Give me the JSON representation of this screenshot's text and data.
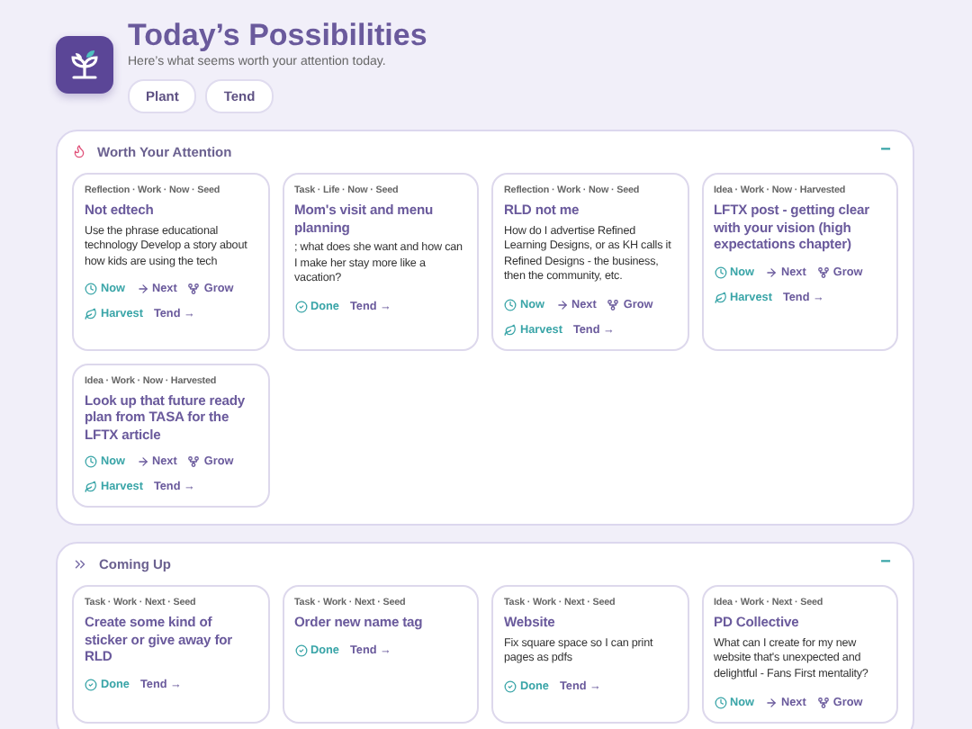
{
  "header": {
    "title": "Today’s Possibilities",
    "subtitle": "Here’s what seems worth your attention today.",
    "buttons": [
      "Plant",
      "Tend"
    ]
  },
  "sections": [
    {
      "title": "Worth Your Attention",
      "kind": "attention",
      "expanded": true,
      "toggle": "−",
      "cards": [
        {
          "meta": "Reflection · Work · Now · Seed",
          "title": "Not edtech",
          "body": "Use the phrase educational technology Develop a story about how kids are using the tech",
          "actions": [
            {
              "kind": "now",
              "label": "Now"
            },
            {
              "kind": "next",
              "label": "Next"
            },
            {
              "kind": "grow",
              "label": "Grow"
            },
            {
              "kind": "harvest",
              "label": "Harvest"
            },
            {
              "kind": "tend",
              "label": "Tend →"
            }
          ]
        },
        {
          "meta": "Task · Life · Now · Seed",
          "title": "Mom's visit and menu planning",
          "body": "; what does she want and how can I make her stay more like a vacation?",
          "actions": [
            {
              "kind": "done",
              "label": "Done"
            },
            {
              "kind": "tend",
              "label": "Tend →"
            }
          ]
        },
        {
          "meta": "Reflection · Work · Now · Seed",
          "title": "RLD not me",
          "body": "How do I advertise Refined Learning Designs, or as KH calls it Refined Designs - the business, then the community, etc.",
          "actions": [
            {
              "kind": "now",
              "label": "Now"
            },
            {
              "kind": "next",
              "label": "Next"
            },
            {
              "kind": "grow",
              "label": "Grow"
            },
            {
              "kind": "harvest",
              "label": "Harvest"
            },
            {
              "kind": "tend",
              "label": "Tend →"
            }
          ]
        },
        {
          "meta": "Idea · Work · Now · Harvested",
          "title": "LFTX post - getting clear with your vision (high expectations chapter)",
          "actions": [
            {
              "kind": "now",
              "label": "Now"
            },
            {
              "kind": "next",
              "label": "Next"
            },
            {
              "kind": "grow",
              "label": "Grow"
            },
            {
              "kind": "harvest",
              "label": "Harvest"
            },
            {
              "kind": "tend",
              "label": "Tend →"
            }
          ]
        },
        {
          "meta": "Idea · Work · Now · Harvested",
          "title": "Look up that future ready plan from TASA for the LFTX article",
          "actions": [
            {
              "kind": "now",
              "label": "Now"
            },
            {
              "kind": "next",
              "label": "Next"
            },
            {
              "kind": "grow",
              "label": "Grow"
            },
            {
              "kind": "harvest",
              "label": "Harvest"
            },
            {
              "kind": "tend",
              "label": "Tend →"
            }
          ]
        }
      ]
    },
    {
      "title": "Coming Up",
      "kind": "upcoming",
      "expanded": true,
      "toggle": "−",
      "cards": [
        {
          "meta": "Task · Work · Next · Seed",
          "title": "Create some kind of sticker or give away for RLD",
          "actions": [
            {
              "kind": "done",
              "label": "Done"
            },
            {
              "kind": "tend",
              "label": "Tend →"
            }
          ]
        },
        {
          "meta": "Task · Work · Next · Seed",
          "title": "Order new name tag",
          "actions": [
            {
              "kind": "done",
              "label": "Done"
            },
            {
              "kind": "tend",
              "label": "Tend →"
            }
          ]
        },
        {
          "meta": "Task · Work · Next · Seed",
          "title": "Website",
          "body": "Fix square space so I can print pages as pdfs",
          "actions": [
            {
              "kind": "done",
              "label": "Done"
            },
            {
              "kind": "tend",
              "label": "Tend →"
            }
          ]
        },
        {
          "meta": "Idea · Work · Next · Seed",
          "title": "PD Collective",
          "body": "What can I create for my new website that's unexpected and delightful - Fans First mentality?",
          "actions": [
            {
              "kind": "now",
              "label": "Now"
            },
            {
              "kind": "next",
              "label": "Next"
            },
            {
              "kind": "grow",
              "label": "Grow"
            }
          ]
        }
      ]
    }
  ]
}
